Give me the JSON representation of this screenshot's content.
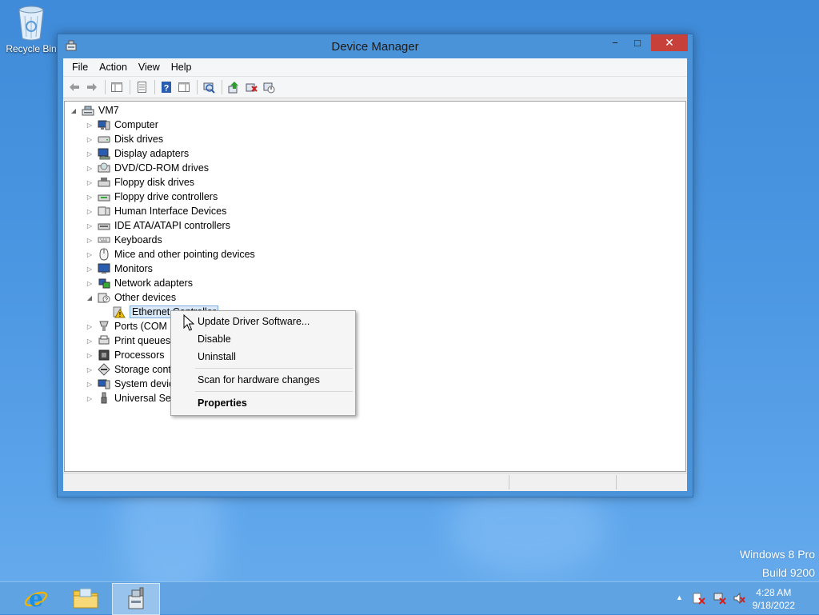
{
  "desktop": {
    "recycle_bin_label": "Recycle Bin",
    "watermark_line1": "Windows 8 Pro",
    "watermark_line2": "Build 9200"
  },
  "window": {
    "title": "Device Manager",
    "minimize_glyph": "−",
    "maximize_glyph": "□",
    "close_glyph": "✕"
  },
  "menubar": [
    "File",
    "Action",
    "View",
    "Help"
  ],
  "toolbar_icons": [
    "back-icon",
    "forward-icon",
    "show-hide-console-tree-icon",
    "properties-icon",
    "help-icon",
    "action-pane-icon",
    "scan-hardware-icon",
    "update-driver-icon",
    "uninstall-icon",
    "disable-icon"
  ],
  "tree": {
    "root": "VM7",
    "categories": [
      "Computer",
      "Disk drives",
      "Display adapters",
      "DVD/CD-ROM drives",
      "Floppy disk drives",
      "Floppy drive controllers",
      "Human Interface Devices",
      "IDE ATA/ATAPI controllers",
      "Keyboards",
      "Mice and other pointing devices",
      "Monitors",
      "Network adapters",
      "Other devices"
    ],
    "selected_child": "Ethernet Controller",
    "categories_after": [
      "Ports (COM &",
      "Print queues",
      "Processors",
      "Storage contr",
      "System devic",
      "Universal Seri"
    ]
  },
  "context_menu": {
    "update": "Update Driver Software...",
    "disable": "Disable",
    "uninstall": "Uninstall",
    "scan": "Scan for hardware changes",
    "properties": "Properties"
  },
  "taskbar": {
    "time": "4:28 AM",
    "date": "9/18/2022",
    "tray_arrow": "▲"
  },
  "colors": {
    "close_button": "#c7403a",
    "window_frame": "#4b93d8",
    "warning": "#f2c200"
  }
}
